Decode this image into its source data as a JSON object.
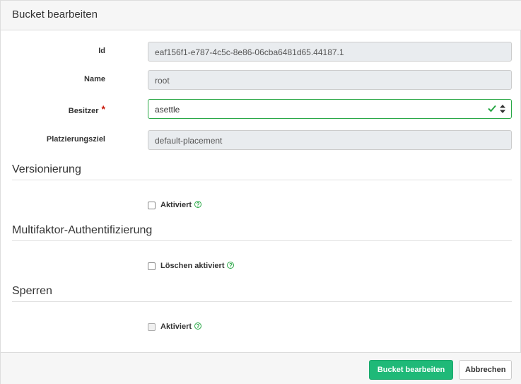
{
  "dialog": {
    "title": "Bucket bearbeiten"
  },
  "form": {
    "id": {
      "label": "Id",
      "value": "eaf156f1-e787-4c5c-8e86-06cba6481d65.44187.1"
    },
    "name": {
      "label": "Name",
      "value": "root"
    },
    "owner": {
      "label": "Besitzer",
      "required_mark": "*",
      "value": "asettle"
    },
    "placement": {
      "label": "Platzierungsziel",
      "value": "default-placement"
    }
  },
  "sections": {
    "versioning": {
      "title": "Versionierung",
      "checkbox_label": "Aktiviert",
      "checked": false
    },
    "mfa": {
      "title": "Multifaktor-Authentifizierung",
      "checkbox_label": "Löschen aktiviert",
      "checked": false
    },
    "locking": {
      "title": "Sperren",
      "checkbox_label": "Aktiviert",
      "checked": false
    }
  },
  "help_glyph": "?",
  "footer": {
    "submit_label": "Bucket bearbeiten",
    "cancel_label": "Abbrechen"
  },
  "colors": {
    "accent": "#1fb978",
    "valid": "#28a745",
    "required": "#c9190b"
  },
  "icons": {
    "check": "checkmark-icon",
    "select": "sort-updown-icon",
    "help": "question-circle-icon"
  }
}
